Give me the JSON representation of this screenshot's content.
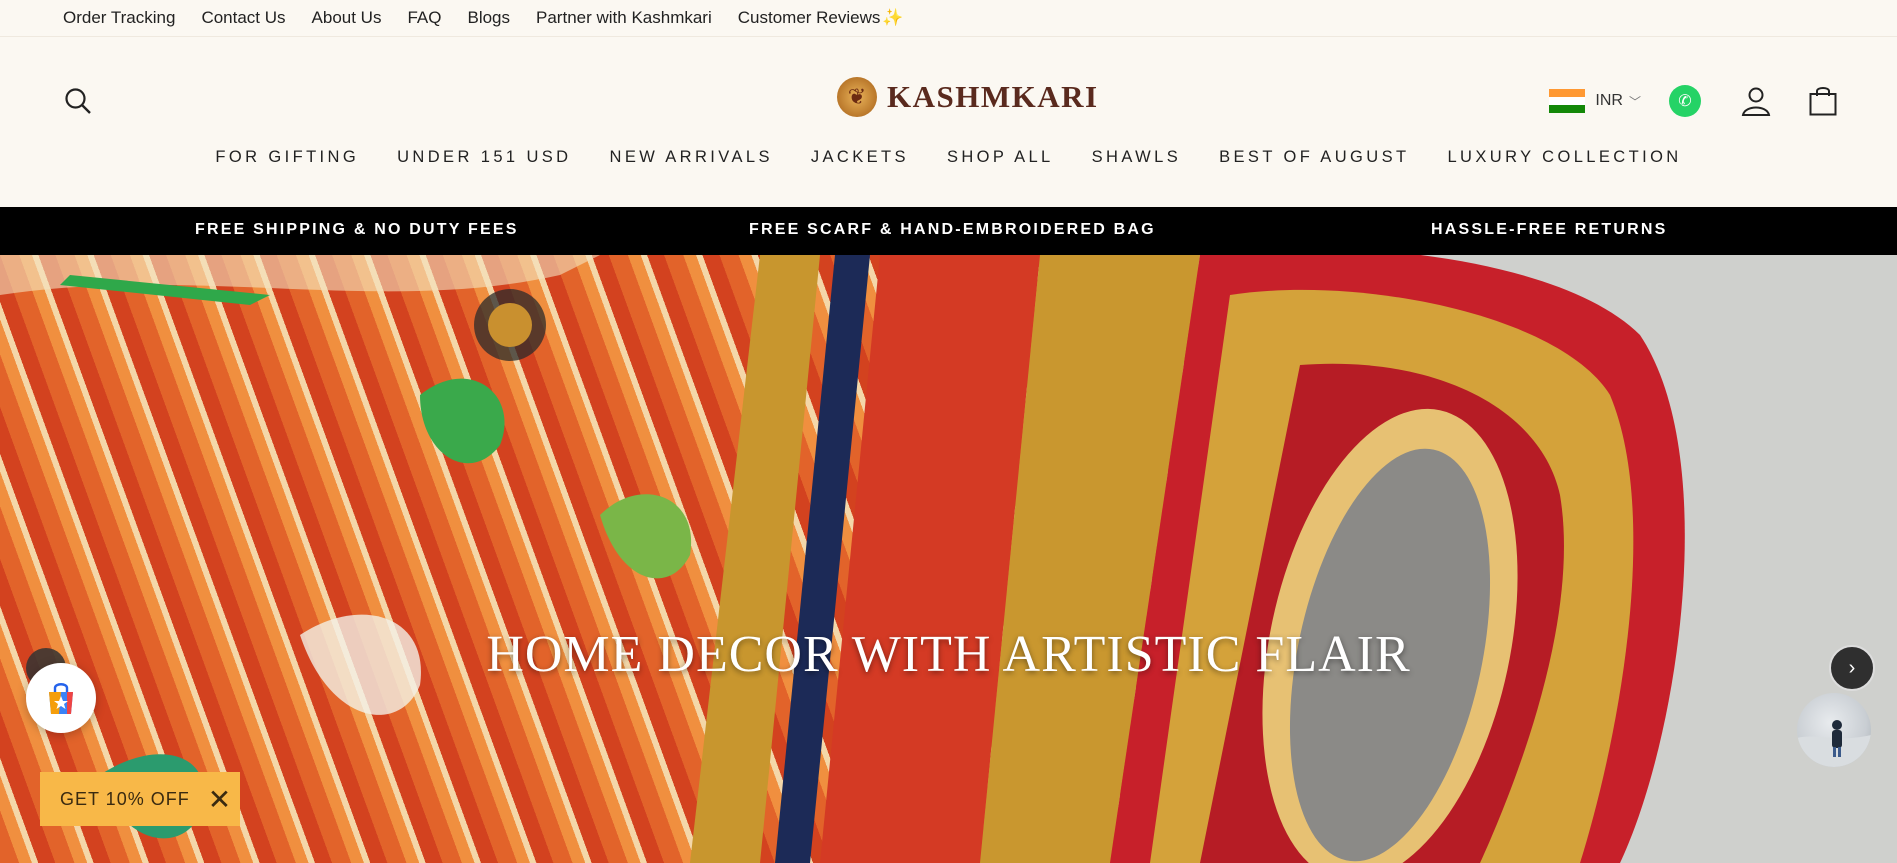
{
  "utility_links": [
    "Order Tracking",
    "Contact Us",
    "About Us",
    "FAQ",
    "Blogs",
    "Partner with Kashmkari",
    "Customer Reviews"
  ],
  "utility_sparkle": "✨",
  "brand": {
    "name": "KASHMKARI"
  },
  "currency": {
    "code": "INR"
  },
  "nav": [
    "FOR GIFTING",
    "UNDER 151 USD",
    "NEW ARRIVALS",
    "JACKETS",
    "SHOP ALL",
    "SHAWLS",
    "BEST OF AUGUST",
    "LUXURY COLLECTION"
  ],
  "announcements": [
    "FREE SHIPPING & NO DUTY FEES",
    "FREE SCARF & HAND-EMBROIDERED BAG",
    "HASSLE-FREE RETURNS"
  ],
  "hero": {
    "title": "HOME DECOR WITH ARTISTIC FLAIR"
  },
  "discount": {
    "label": "GET 10% OFF",
    "close": "✕"
  },
  "colors": {
    "announce_bg": "#000000",
    "discount_bg": "#f8b848",
    "whatsapp": "#25d366",
    "brand_text": "#5a2a1e"
  }
}
